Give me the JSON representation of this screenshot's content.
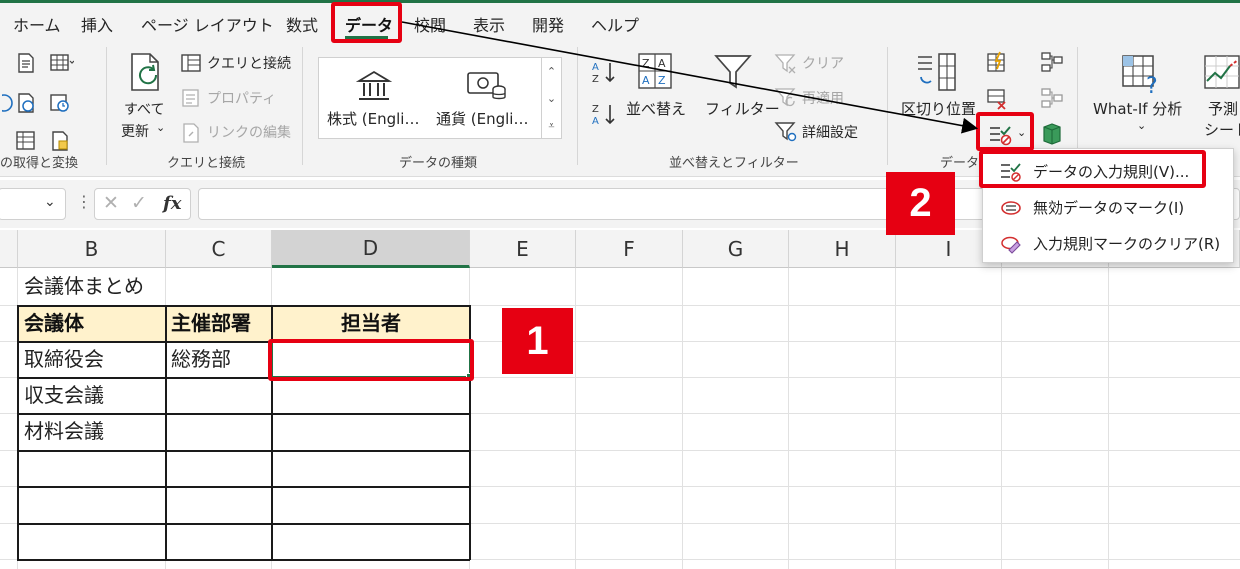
{
  "tabs": [
    "ホーム",
    "挿入",
    "ページ レイアウト",
    "数式",
    "データ",
    "校閲",
    "表示",
    "開発",
    "ヘルプ"
  ],
  "ribbon": {
    "get_transform": {
      "group_label": "の取得と変換"
    },
    "queries": {
      "refresh_line1": "すべて",
      "refresh_line2": "更新",
      "queries_connections": "クエリと接続",
      "properties": "プロパティ",
      "edit_links": "リンクの編集",
      "group_label": "クエリと接続"
    },
    "data_types": {
      "stocks": "株式 (Engli…",
      "currencies": "通貨 (Engli…",
      "group_label": "データの種類"
    },
    "sort_filter": {
      "sort": "並べ替え",
      "filter": "フィルター",
      "clear": "クリア",
      "reapply": "再適用",
      "advanced": "詳細設定",
      "group_label": "並べ替えとフィルター"
    },
    "data_tools": {
      "text_to_columns": "区切り位置",
      "group_label_partial": "データ"
    },
    "forecast": {
      "what_if": "What-If 分析",
      "forecast_sheet_line1": "予測",
      "forecast_sheet_line2": "シート"
    }
  },
  "formula_bar": {
    "fx": "fx",
    "cancel": "✕",
    "enter": "✓"
  },
  "columns": [
    "B",
    "C",
    "D",
    "E",
    "F",
    "G",
    "H",
    "I"
  ],
  "sheet": {
    "title": "会議体まとめ",
    "headers": [
      "会議体",
      "主催部署",
      "担当者"
    ],
    "rows": [
      [
        "取締役会",
        "総務部",
        ""
      ],
      [
        "収支会議",
        "",
        ""
      ],
      [
        "材料会議",
        "",
        ""
      ],
      [
        "",
        "",
        ""
      ],
      [
        "",
        "",
        ""
      ],
      [
        "",
        "",
        ""
      ]
    ]
  },
  "menu": {
    "items": [
      "データの入力規則(V)...",
      "無効データのマーク(I)",
      "入力規則マークのクリア(R)"
    ]
  },
  "annotations": {
    "step1": "1",
    "step2": "2"
  },
  "colors": {
    "accent": "#217346",
    "highlight": "#e60012",
    "header_fill": "#fff2cc"
  }
}
